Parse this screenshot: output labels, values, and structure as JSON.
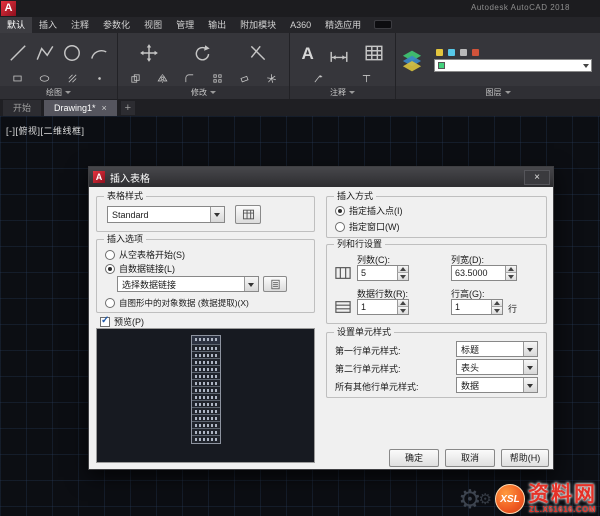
{
  "icons": {
    "close": "×",
    "plus": "+",
    "gear": "⚙",
    "text_tool": "A"
  },
  "titlebar": {
    "app_title": "Autodesk AutoCAD 2018"
  },
  "ribbon_tabs": {
    "active": "默认",
    "items": [
      "默认",
      "插入",
      "注释",
      "参数化",
      "视图",
      "管理",
      "输出",
      "附加模块",
      "A360",
      "精选应用"
    ]
  },
  "ribbon_panels": {
    "draw_label": "绘图",
    "modify_label": "修改",
    "annotate_label": "注释",
    "layers_label": "图层"
  },
  "file_tabs": {
    "start": "开始",
    "drawing": "Drawing1*"
  },
  "viewport": {
    "controls": "[-][俯视][二维线框]"
  },
  "dialog": {
    "title": "插入表格",
    "table_style": {
      "group_label": "表格样式",
      "selected": "Standard"
    },
    "insert_options": {
      "group_label": "插入选项",
      "from_empty": "从空表格开始(S)",
      "from_data_link": "自数据链接(L)",
      "data_link_value": "选择数据链接",
      "from_object_data": "自图形中的对象数据 (数据提取)(X)"
    },
    "preview": {
      "checkbox_label": "预览(P)"
    },
    "insertion_behavior": {
      "group_label": "插入方式",
      "specify_point": "指定插入点(I)",
      "specify_window": "指定窗口(W)"
    },
    "column_row": {
      "group_label": "列和行设置",
      "columns_label": "列数(C):",
      "columns_value": "5",
      "col_width_label": "列宽(D):",
      "col_width_value": "63.5000",
      "data_rows_label": "数据行数(R):",
      "data_rows_value": "1",
      "row_height_label": "行高(G):",
      "row_height_value": "1",
      "row_height_unit": "行"
    },
    "cell_styles": {
      "group_label": "设置单元样式",
      "first_row_label": "第一行单元样式:",
      "first_row_value": "标题",
      "second_row_label": "第二行单元样式:",
      "second_row_value": "表头",
      "other_rows_label": "所有其他行单元样式:",
      "other_rows_value": "数据"
    },
    "buttons": {
      "ok": "确定",
      "cancel": "取消",
      "help": "帮助(H)"
    }
  },
  "watermark": {
    "logo": "XSL",
    "name": "资料网",
    "url": "ZL.X51616.COM"
  }
}
